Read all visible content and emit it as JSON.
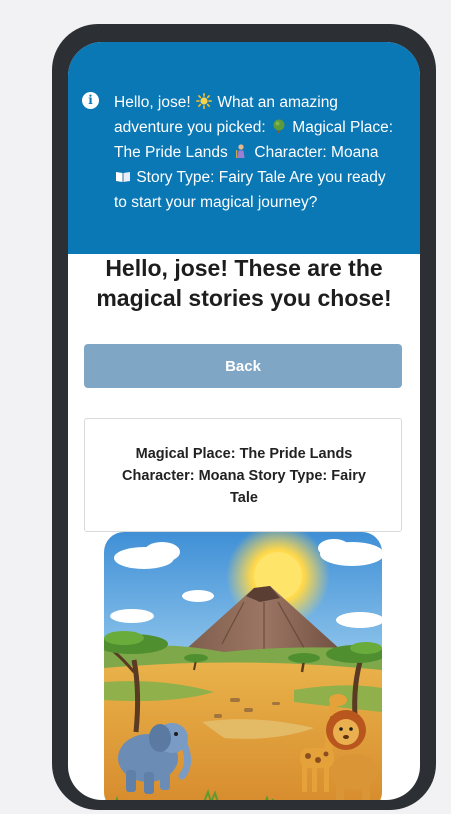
{
  "alert": {
    "icon": "info-icon",
    "greeting": "Hello, jose!",
    "line_intro": "What an amazing adventure you picked:",
    "place": "Magical Place: The Pride Lands",
    "character": "Character: Moana",
    "story_type": "Story Type: Fairy Tale",
    "question": "Are you ready to start your magical journey?",
    "background_color": "#0a78b5"
  },
  "main": {
    "headline": "Hello, jose! These are the magical stories you chose!",
    "back_label": "Back",
    "summary": "Magical Place: The Pride Lands Character: Moana Story Type: Fairy Tale",
    "button_color": "#7fa6c5"
  },
  "illustration": {
    "subject": "savanna scene with a volcano mountain, elephant, giraffe and lion"
  }
}
